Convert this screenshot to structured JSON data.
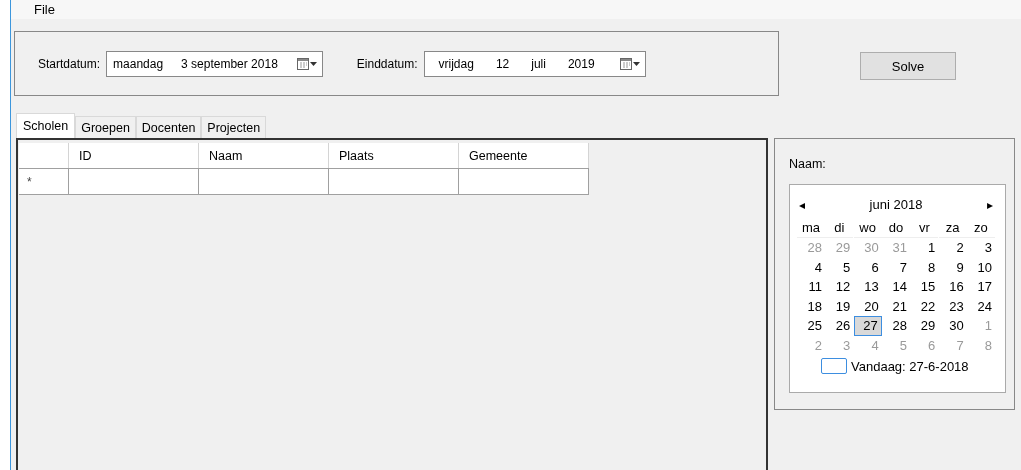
{
  "menu": [
    "File"
  ],
  "dates": [
    {
      "label": "Startdatum:",
      "parts": [
        "maandag",
        "3 september 2018"
      ]
    },
    {
      "label": "Einddatum:",
      "parts": [
        "vrijdag",
        "12",
        "juli",
        "2019"
      ]
    }
  ],
  "solve_button": "Solve",
  "tabs": [
    {
      "label": "Scholen",
      "selected": true
    },
    {
      "label": "Groepen",
      "selected": false
    },
    {
      "label": "Docenten",
      "selected": false
    },
    {
      "label": "Projecten",
      "selected": false
    }
  ],
  "table": {
    "columns": [
      "ID",
      "Naam",
      "Plaats",
      "Gemeente"
    ],
    "new_row_marker": "*"
  },
  "side_panel": {
    "label": "Naam:",
    "calendar": {
      "month": "juni 2018",
      "prev": "◂",
      "next": "▸",
      "weekdays": [
        "ma",
        "di",
        "wo",
        "do",
        "vr",
        "za",
        "zo"
      ],
      "weeks": [
        [
          {
            "day": "28",
            "outside": true,
            "selected": false
          },
          {
            "day": "29",
            "outside": true,
            "selected": false
          },
          {
            "day": "30",
            "outside": true,
            "selected": false
          },
          {
            "day": "31",
            "outside": true,
            "selected": false
          },
          {
            "day": "1",
            "outside": false,
            "selected": false
          },
          {
            "day": "2",
            "outside": false,
            "selected": false
          },
          {
            "day": "3",
            "outside": false,
            "selected": false
          }
        ],
        [
          {
            "day": "4",
            "outside": false,
            "selected": false
          },
          {
            "day": "5",
            "outside": false,
            "selected": false
          },
          {
            "day": "6",
            "outside": false,
            "selected": false
          },
          {
            "day": "7",
            "outside": false,
            "selected": false
          },
          {
            "day": "8",
            "outside": false,
            "selected": false
          },
          {
            "day": "9",
            "outside": false,
            "selected": false
          },
          {
            "day": "10",
            "outside": false,
            "selected": false
          }
        ],
        [
          {
            "day": "11",
            "outside": false,
            "selected": false
          },
          {
            "day": "12",
            "outside": false,
            "selected": false
          },
          {
            "day": "13",
            "outside": false,
            "selected": false
          },
          {
            "day": "14",
            "outside": false,
            "selected": false
          },
          {
            "day": "15",
            "outside": false,
            "selected": false
          },
          {
            "day": "16",
            "outside": false,
            "selected": false
          },
          {
            "day": "17",
            "outside": false,
            "selected": false
          }
        ],
        [
          {
            "day": "18",
            "outside": false,
            "selected": false
          },
          {
            "day": "19",
            "outside": false,
            "selected": false
          },
          {
            "day": "20",
            "outside": false,
            "selected": false
          },
          {
            "day": "21",
            "outside": false,
            "selected": false
          },
          {
            "day": "22",
            "outside": false,
            "selected": false
          },
          {
            "day": "23",
            "outside": false,
            "selected": false
          },
          {
            "day": "24",
            "outside": false,
            "selected": false
          }
        ],
        [
          {
            "day": "25",
            "outside": false,
            "selected": false
          },
          {
            "day": "26",
            "outside": false,
            "selected": false
          },
          {
            "day": "27",
            "outside": false,
            "selected": true
          },
          {
            "day": "28",
            "outside": false,
            "selected": false
          },
          {
            "day": "29",
            "outside": false,
            "selected": false
          },
          {
            "day": "30",
            "outside": false,
            "selected": false
          },
          {
            "day": "1",
            "outside": true,
            "selected": false
          }
        ],
        [
          {
            "day": "2",
            "outside": true,
            "selected": false
          },
          {
            "day": "3",
            "outside": true,
            "selected": false
          },
          {
            "day": "4",
            "outside": true,
            "selected": false
          },
          {
            "day": "5",
            "outside": true,
            "selected": false
          },
          {
            "day": "6",
            "outside": true,
            "selected": false
          },
          {
            "day": "7",
            "outside": true,
            "selected": false
          },
          {
            "day": "8",
            "outside": true,
            "selected": false
          }
        ]
      ],
      "today": "Vandaag: 27-6-2018"
    }
  }
}
